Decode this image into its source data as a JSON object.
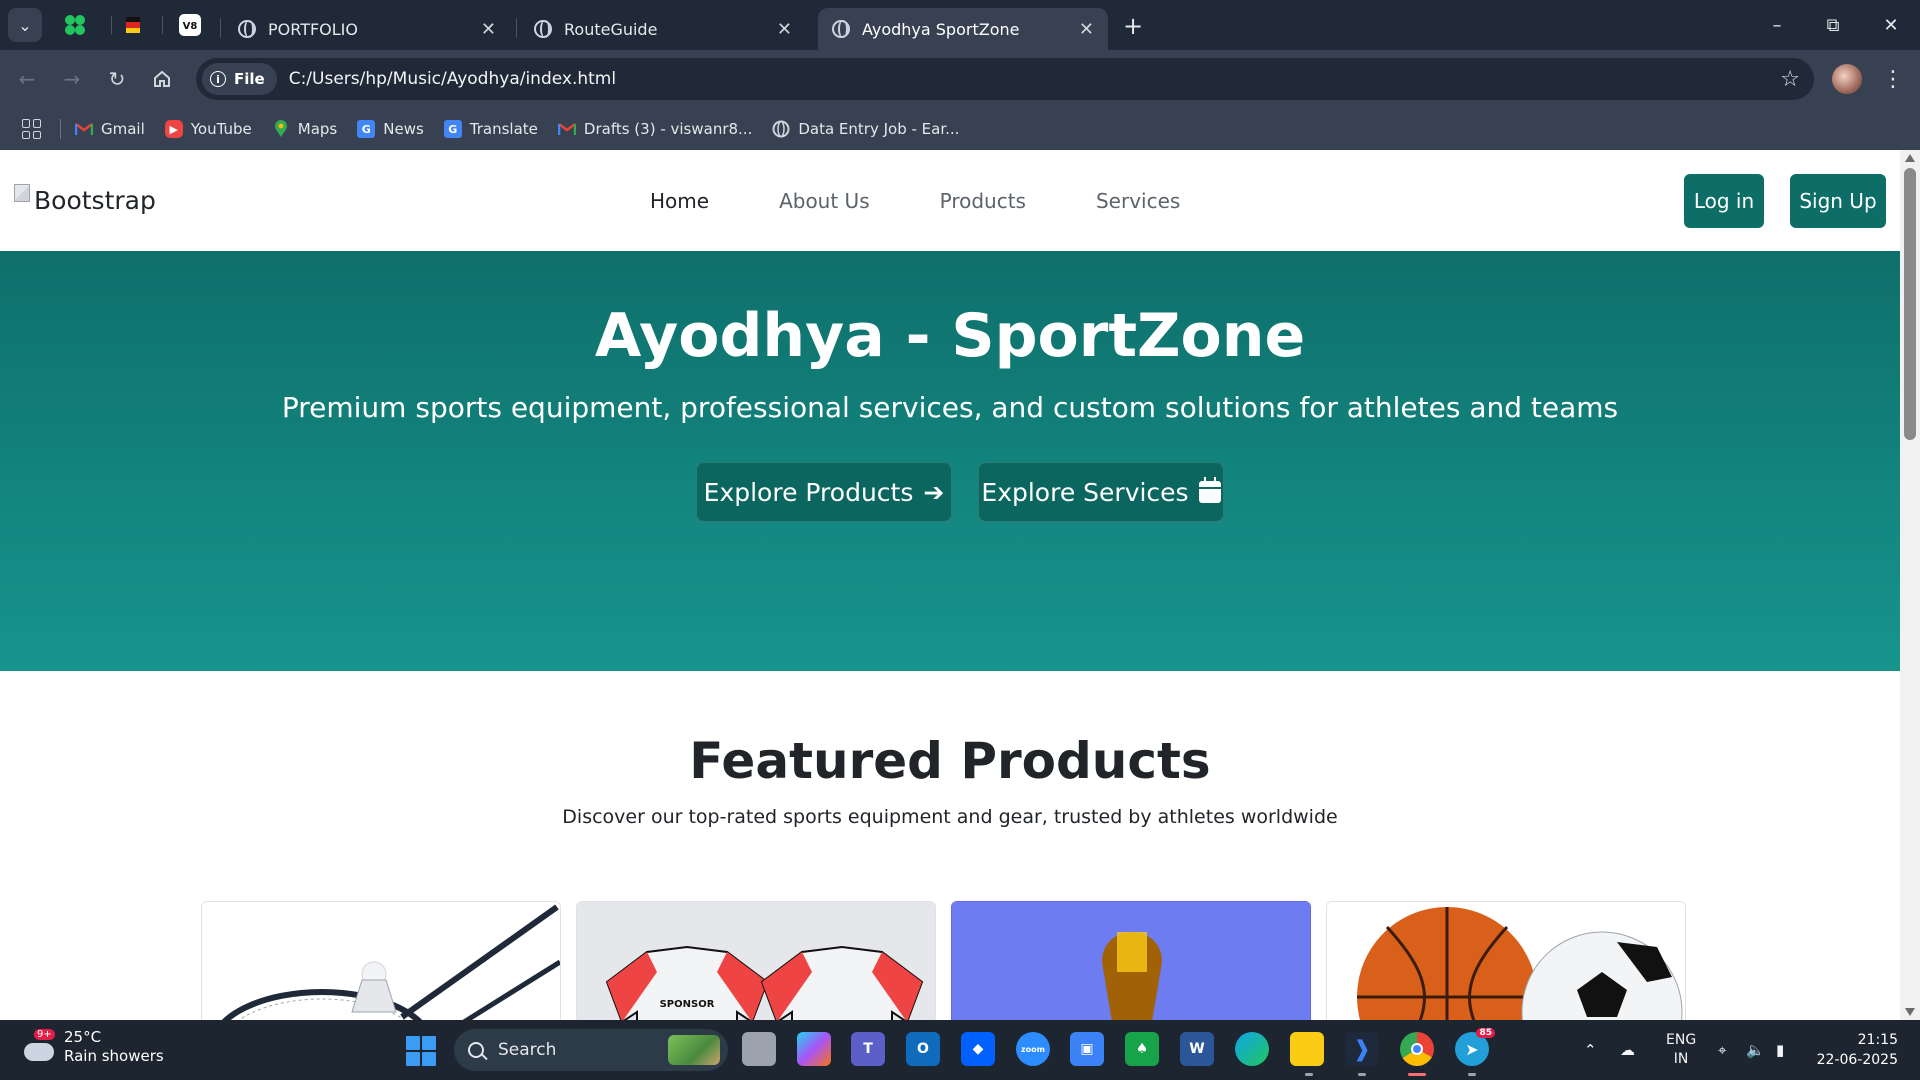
{
  "browser": {
    "tabs": [
      {
        "title": "PORTFOLIO"
      },
      {
        "title": "RouteGuide"
      },
      {
        "title": "Ayodhya SportZone"
      }
    ],
    "site_chip": "File",
    "url": "C:/Users/hp/Music/Ayodhya/index.html",
    "bookmarks": [
      "Gmail",
      "YouTube",
      "Maps",
      "News",
      "Translate",
      "Drafts (3) - viswanr8...",
      "Data Entry Job - Ear..."
    ]
  },
  "site": {
    "brand_alt": "Bootstrap",
    "nav": [
      "Home",
      "About Us",
      "Products",
      "Services"
    ],
    "login": "Log in",
    "signup": "Sign Up"
  },
  "hero": {
    "title": "Ayodhya - SportZone",
    "subtitle": "Premium sports equipment, professional services, and custom solutions for athletes and teams",
    "btn_products": "Explore Products",
    "btn_services": "Explore Services"
  },
  "featured": {
    "title": "Featured Products",
    "subtitle": "Discover our top-rated sports equipment and gear, trusted by athletes worldwide",
    "jersey_text": "SPONSOR"
  },
  "taskbar": {
    "temp": "25°C",
    "weather": "Rain showers",
    "weather_badge": "9+",
    "search": "Search",
    "lang": "ENG",
    "region": "IN",
    "time": "21:15",
    "date": "22-06-2025",
    "telegram_badge": "85",
    "zoom_label": "zoom"
  },
  "colors": {
    "accent": "#0d6e68",
    "hero_top": "#0f6f6b",
    "hero_bottom": "#16958d",
    "chrome_dark": "#1f2937",
    "taskbar": "#1c2530"
  }
}
